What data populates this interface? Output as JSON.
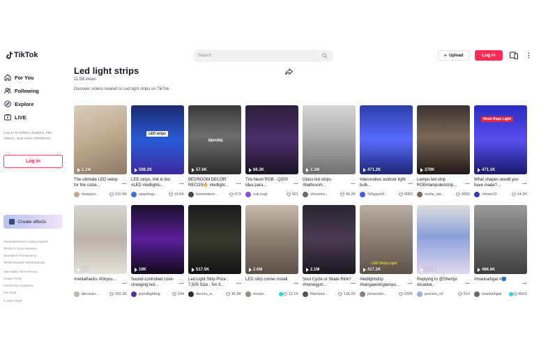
{
  "header": {
    "logo_text": "TikTok",
    "search_placeholder": "Search",
    "upload_label": "Upload",
    "login_label": "Log in",
    "more": "⋮"
  },
  "sidebar": {
    "items": [
      {
        "label": "For You",
        "icon": "home-icon"
      },
      {
        "label": "Following",
        "icon": "following-icon"
      },
      {
        "label": "Explore",
        "icon": "compass-icon"
      },
      {
        "label": "LIVE",
        "icon": "live-icon"
      }
    ],
    "hint": "Log in to follow creators, like videos, and view comments.",
    "login_label": "Log in",
    "effects_label": "Create effects",
    "footer": [
      "About  Newsroom  Contact  Careers",
      "TikTok for Good  Advertise",
      "Developers  Transparency",
      "TikTok Rewards  TikTok Embeds",
      "Help  Safety  Terms  Privacy",
      "Creator Portal",
      "Community Guidelines",
      "See more ⌄",
      "© 2023 TikTok"
    ]
  },
  "main": {
    "title": "Led light strips",
    "views": "11.5B views",
    "description": "Discover videos related to Led light strips on TikTok."
  },
  "videos": [
    {
      "plays": "2.2M",
      "caption": "The ultimate LED setup for the cozie...",
      "user": "maisylei...",
      "likes": "110.9K",
      "overlay": ""
    },
    {
      "plays": "598.2K",
      "caption": "LED strips, link in bio #LED #ledlights...",
      "user": "stepshop...",
      "likes": "10.6K",
      "overlay": "LED strips"
    },
    {
      "plays": "57.6K",
      "caption": "BEDROOM DECOR RECOS🔥 #ledlight...",
      "user": "twomettere...",
      "likes": "673",
      "overlay": "BEFORE"
    },
    {
      "plays": "66.3K",
      "caption": "Tira Neon RGB - Q200 Idea para...",
      "user": "zuk.kogt",
      "likes": "921",
      "overlay": ""
    },
    {
      "plays": "2.3M",
      "caption": "Glass led strips #bathroom...",
      "user": "zhuoxinc...",
      "likes": "34.2K",
      "overlay": ""
    },
    {
      "plays": "471.2K",
      "caption": "#decorative outdoor light bulb...",
      "user": "SiSgqob3...",
      "likes": "9083",
      "overlay": ""
    },
    {
      "plays": "270K",
      "caption": "Lampu led strip RGB#lampuledstrip...",
      "user": "serba_ele...",
      "likes": "3583",
      "overlay": ""
    },
    {
      "plays": "471.1K",
      "caption": "What shapes would you have made?...",
      "user": "chrissi10",
      "likes": "14.3K",
      "overlay": "Neon Rope Light"
    },
    {
      "plays": "4M",
      "caption": "#rentalhacks #foryou...",
      "user": "decoran...",
      "likes": "193.3K",
      "overlay": ""
    },
    {
      "plays": "19K",
      "caption": "Sound-controlled color-changing led...",
      "user": "joyedlighting",
      "likes": "144",
      "overlay": ""
    },
    {
      "plays": "517.5K",
      "caption": "Led Light Strip Price ; 7,500 Size ; 5m lt...",
      "user": "decors_a...",
      "likes": "15.9K",
      "overlay": ""
    },
    {
      "plays": "2.6M",
      "caption": "LED strip corner install",
      "user": "mome...",
      "likes": "12.1K",
      "overlay": "",
      "verified": true
    },
    {
      "plays": "2.1M",
      "caption": "Soul Cycle or Skate Rink? #homegym...",
      "user": "theclaire...",
      "likes": "116.2K",
      "overlay": ""
    },
    {
      "plays": "417.2K",
      "caption": "#ledlightstrip #hangawiringlampu...",
      "user": "jomeszke...",
      "likes": "3305",
      "overlay": "LED Strip Light"
    },
    {
      "plays": "32.1K",
      "caption": "Replying to @Sherlyn Alcantar...",
      "user": "preciou_s2",
      "likes": "514",
      "overlay": ""
    },
    {
      "plays": "486.8K",
      "caption": "#manisehgal #🔵",
      "user": "manisehgal",
      "likes": "8916",
      "overlay": "",
      "verified": true
    }
  ],
  "colors": {
    "brand_red": "#fe2c55",
    "text": "#161823",
    "muted": "#8a8b91"
  }
}
